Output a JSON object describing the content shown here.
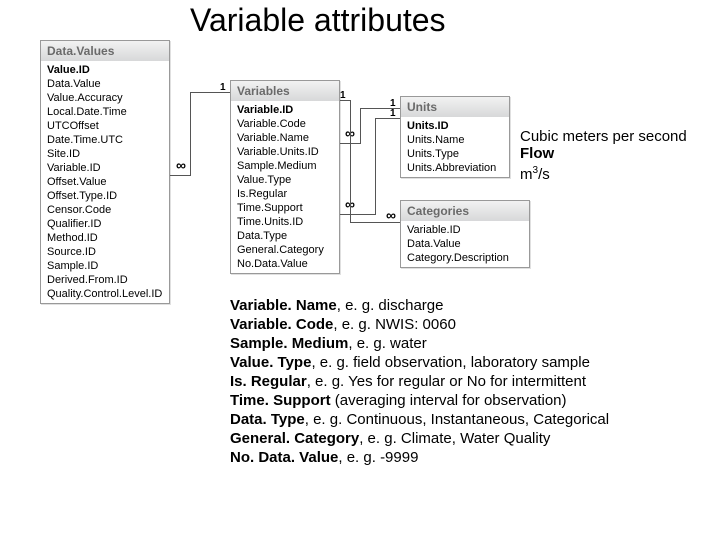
{
  "title": "Variable attributes",
  "tables": {
    "dataValues": {
      "header": "Data.Values",
      "fields": [
        "Value.ID",
        "Data.Value",
        "Value.Accuracy",
        "Local.Date.Time",
        "UTCOffset",
        "Date.Time.UTC",
        "Site.ID",
        "Variable.ID",
        "Offset.Value",
        "Offset.Type.ID",
        "Censor.Code",
        "Qualifier.ID",
        "Method.ID",
        "Source.ID",
        "Sample.ID",
        "Derived.From.ID",
        "Quality.Control.Level.ID"
      ]
    },
    "variables": {
      "header": "Variables",
      "fields": [
        "Variable.ID",
        "Variable.Code",
        "Variable.Name",
        "Variable.Units.ID",
        "Sample.Medium",
        "Value.Type",
        "Is.Regular",
        "Time.Support",
        "Time.Units.ID",
        "Data.Type",
        "General.Category",
        "No.Data.Value"
      ]
    },
    "units": {
      "header": "Units",
      "fields": [
        "Units.ID",
        "Units.Name",
        "Units.Type",
        "Units.Abbreviation"
      ]
    },
    "categories": {
      "header": "Categories",
      "fields": [
        "Variable.ID",
        "Data.Value",
        "Category.Description"
      ]
    }
  },
  "annotations": {
    "units_line1": "Cubic meters per second",
    "units_line2": "Flow",
    "units_line3_a": "m",
    "units_line3_b": "3",
    "units_line3_c": "/s"
  },
  "descriptions": [
    {
      "key": "Variable. Name",
      "eg": ", e. g. discharge"
    },
    {
      "key": "Variable. Code",
      "eg": ", e. g. NWIS: 0060"
    },
    {
      "key": "Sample. Medium",
      "eg": ", e. g. water"
    },
    {
      "key": "Value. Type",
      "eg": ", e. g. field observation, laboratory sample"
    },
    {
      "key": "Is. Regular",
      "eg": ", e. g. Yes for regular or No for intermittent"
    },
    {
      "key": "Time. Support",
      "eg": " (averaging interval for observation)"
    },
    {
      "key": "Data. Type",
      "eg": ", e. g. Continuous, Instantaneous, Categorical"
    },
    {
      "key": "General. Category",
      "eg": ", e. g. Climate, Water Quality"
    },
    {
      "key": "No. Data. Value",
      "eg": ", e. g. -9999"
    }
  ],
  "cardinality": {
    "one": "1",
    "many": "∞"
  }
}
